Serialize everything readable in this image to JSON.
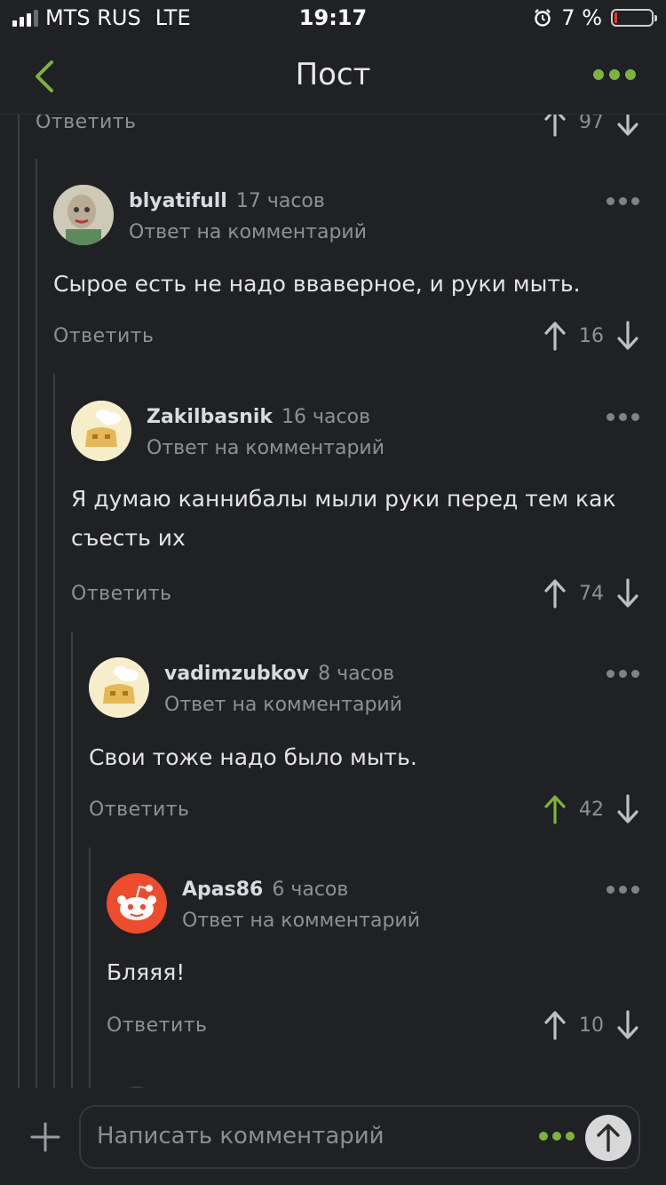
{
  "status_bar": {
    "carrier": "MTS RUS",
    "network": "LTE",
    "time": "19:17",
    "battery_percent": "7 %",
    "battery_level": 0.07
  },
  "navbar": {
    "title": "Пост",
    "accent_color": "#7db33c"
  },
  "top_partial": {
    "reply_label": "Ответить",
    "score": "97"
  },
  "comments": [
    {
      "username": "blyatifull",
      "time": "17 часов",
      "subtitle": "Ответ на комментарий",
      "text": "Сырое есть не надо вваверное, и руки мыть.",
      "reply_label": "Ответить",
      "score": "16",
      "upvoted": false
    },
    {
      "username": "Zakilbasnik",
      "time": "16 часов",
      "subtitle": "Ответ на комментарий",
      "text": "Я думаю каннибалы мыли руки перед тем как съесть их",
      "reply_label": "Ответить",
      "score": "74",
      "upvoted": false
    },
    {
      "username": "vadimzubkov",
      "time": "8 часов",
      "subtitle": "Ответ на комментарий",
      "text": "Свои тоже надо было мыть.",
      "reply_label": "Ответить",
      "score": "42",
      "upvoted": true
    },
    {
      "username": "Apas86",
      "time": "6 часов",
      "subtitle": "Ответ на комментарий",
      "text": "Бляяя!",
      "reply_label": "Ответить",
      "score": "10",
      "upvoted": false
    }
  ],
  "composer": {
    "placeholder": "Написать комментарий"
  }
}
